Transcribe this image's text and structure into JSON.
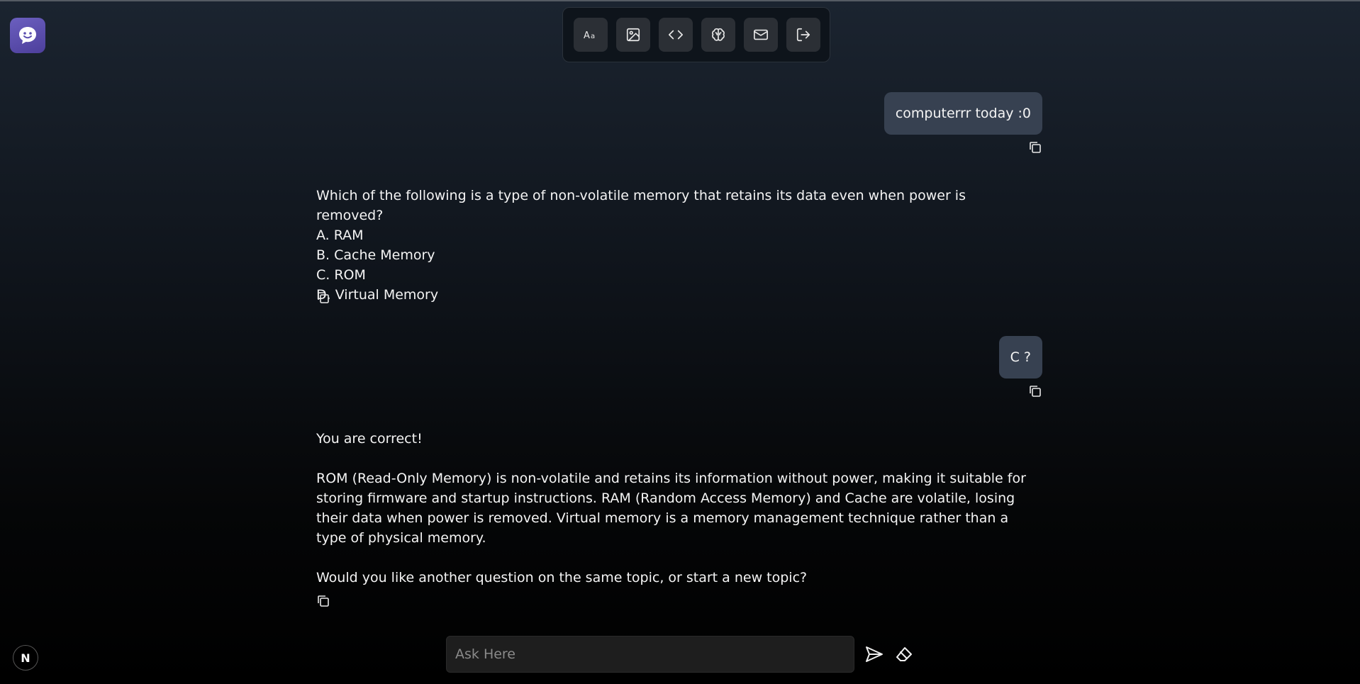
{
  "toolbar": {
    "items": [
      {
        "icon": "text-format-icon"
      },
      {
        "icon": "image-icon"
      },
      {
        "icon": "code-icon"
      },
      {
        "icon": "brain-icon"
      },
      {
        "icon": "mail-icon"
      },
      {
        "icon": "logout-icon"
      }
    ]
  },
  "messages": {
    "user1": "computerrr today :0",
    "bot1": {
      "question": "Which of the following is a type of non-volatile memory that retains its data even when power is removed?",
      "options": [
        "A. RAM",
        "B. Cache Memory",
        "C. ROM",
        "D. Virtual Memory"
      ]
    },
    "user2": "C ?",
    "bot2": {
      "line1": "You are correct!",
      "para1": "ROM (Read-Only Memory) is non-volatile and retains its information without power, making it suitable for storing firmware and startup instructions. RAM (Random Access Memory) and Cache are volatile, losing their data when power is removed. Virtual memory is a memory management technique rather than a type of physical memory.",
      "line2": "Would you like another question on the same topic, or start a new topic?"
    }
  },
  "input": {
    "placeholder": "Ask Here",
    "value": ""
  },
  "badge": "N",
  "colors": {
    "user_bubble": "#374151",
    "logo": "#5b4fb0",
    "toolbar_button": "#2b2f35"
  }
}
